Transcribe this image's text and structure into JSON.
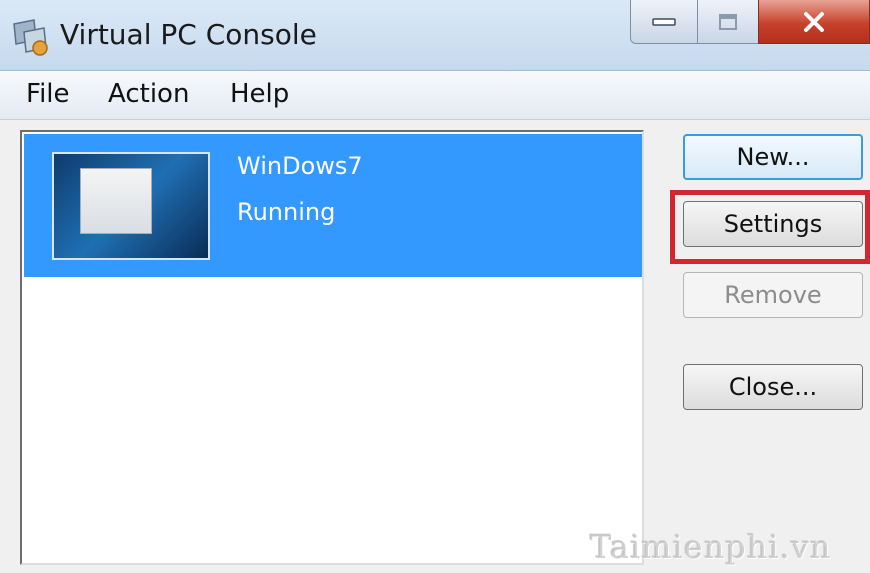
{
  "window": {
    "title": "Virtual PC Console",
    "icon": "virtual-pc-icon"
  },
  "caption_buttons": {
    "minimize_icon": "minimize-icon",
    "maximize_icon": "maximize-icon",
    "close_icon": "close-icon"
  },
  "menu": {
    "items": [
      {
        "label": "File"
      },
      {
        "label": "Action"
      },
      {
        "label": "Help"
      }
    ]
  },
  "vm_list": {
    "items": [
      {
        "name": "WinDows7",
        "status": "Running",
        "selected": true
      }
    ]
  },
  "buttons": {
    "new_label": "New...",
    "settings_label": "Settings",
    "remove_label": "Remove",
    "close_label": "Close..."
  },
  "colors": {
    "selection": "#3399ff",
    "highlight": "#d3262e",
    "close_button": "#c7412b"
  },
  "watermark": "Taimienphi.vn"
}
